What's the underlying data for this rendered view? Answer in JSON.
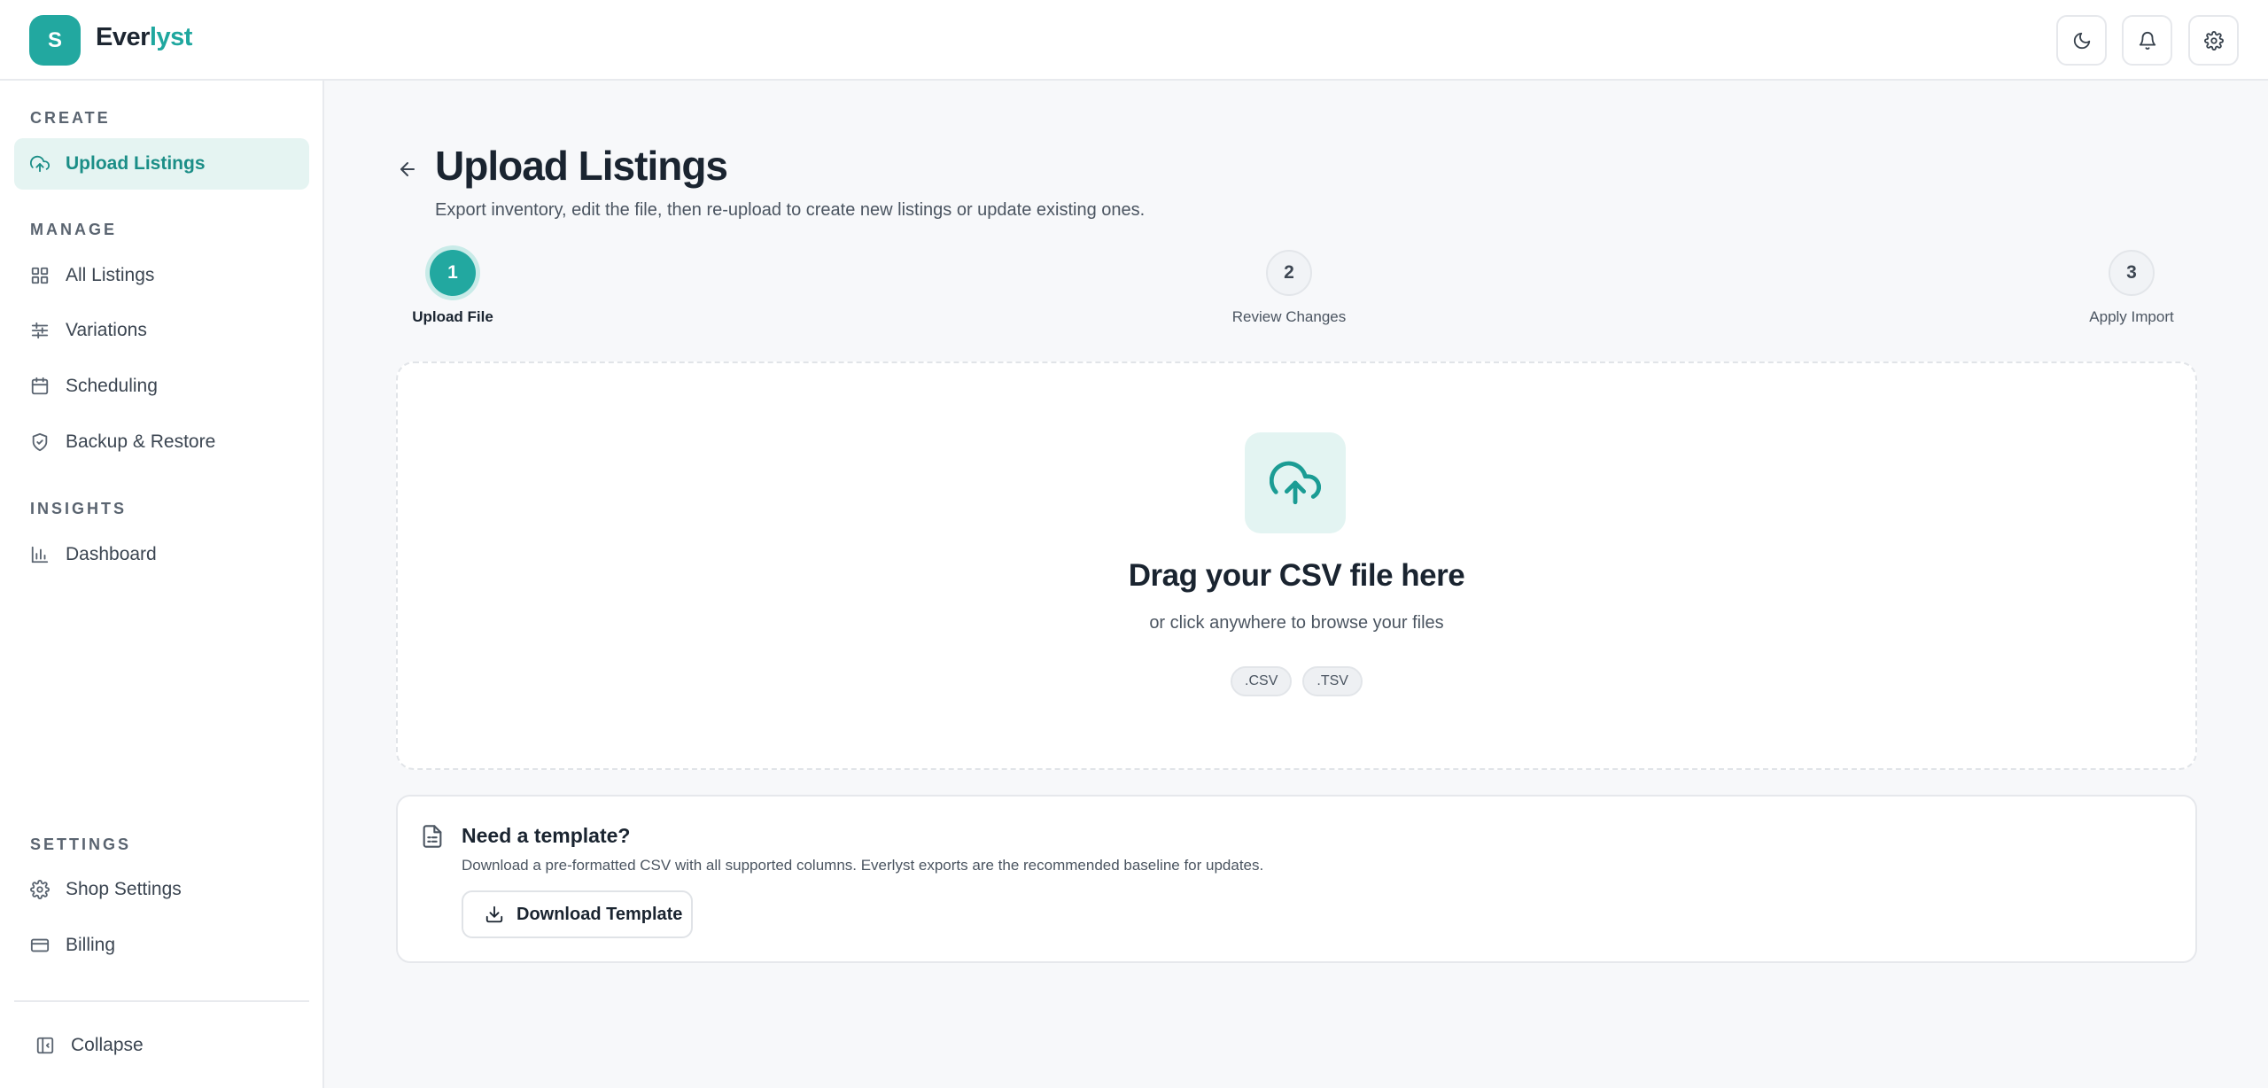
{
  "app": {
    "avatar_letter": "S",
    "brand_prefix": "Ever",
    "brand_accent": "lyst",
    "accent_color": "#22a8a0"
  },
  "topbar": {
    "icons": [
      "moon-icon",
      "bell-icon",
      "gear-icon"
    ]
  },
  "sidebar": {
    "sections": {
      "create": "CREATE",
      "manage": "MANAGE",
      "insights": "INSIGHTS",
      "settings": "SETTINGS"
    },
    "items": [
      {
        "label": "Upload Listings",
        "icon": "cloud-upload-icon",
        "active": true
      },
      {
        "label": "All Listings",
        "icon": "grid-icon"
      },
      {
        "label": "Variations",
        "icon": "sliders-icon"
      },
      {
        "label": "Scheduling",
        "icon": "calendar-icon"
      },
      {
        "label": "Backup & Restore",
        "icon": "shield-icon"
      },
      {
        "label": "Dashboard",
        "icon": "bar-chart-icon"
      },
      {
        "label": "Shop Settings",
        "icon": "gear-icon"
      },
      {
        "label": "Billing",
        "icon": "credit-card-icon"
      }
    ],
    "collapse_label": "Collapse"
  },
  "main": {
    "title": "Upload Listings",
    "subtitle": "Export inventory, edit the file, then re-upload to create new listings or update existing ones.",
    "steps": [
      {
        "number": "1",
        "label": "Upload File",
        "state": "active"
      },
      {
        "number": "2",
        "label": "Review Changes",
        "state": "pending"
      },
      {
        "number": "3",
        "label": "Apply Import",
        "state": "pending"
      }
    ],
    "dropzone": {
      "title": "Drag your CSV file here",
      "subtitle": "or click anywhere to browse your files",
      "formats": [
        ".CSV",
        ".TSV"
      ]
    },
    "template": {
      "title": "Need a template?",
      "description": "Download a pre-formatted CSV with all supported columns. Everlyst exports are the recommended baseline for updates.",
      "button_label": "Download Template"
    }
  }
}
